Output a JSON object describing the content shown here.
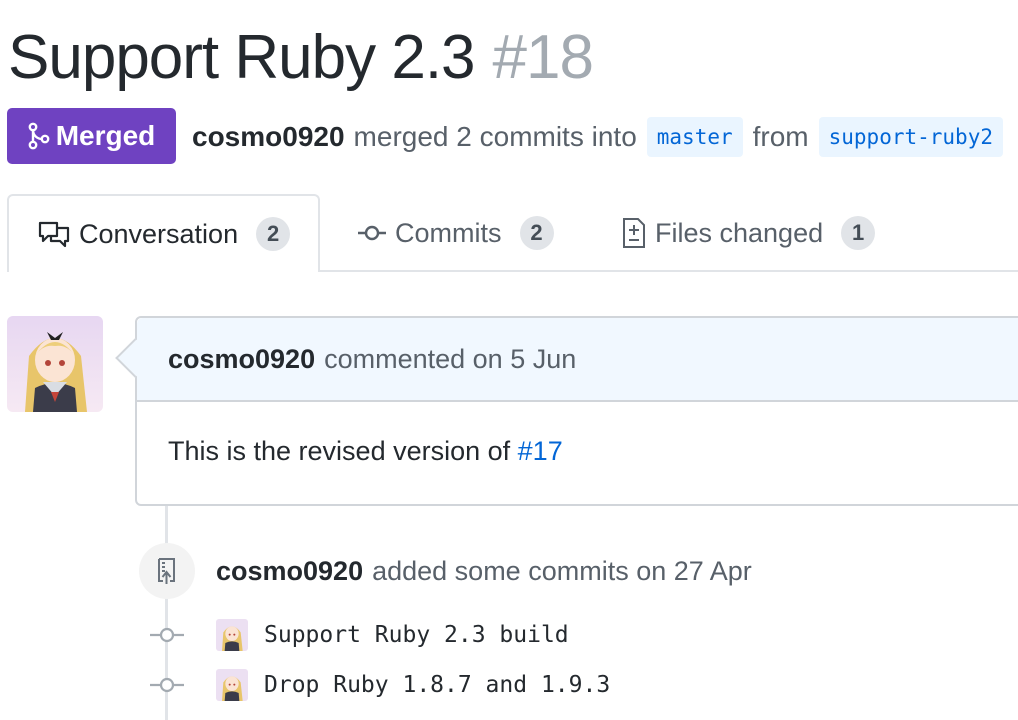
{
  "pr": {
    "title": "Support Ruby 2.3",
    "number": "#18",
    "state": "Merged",
    "author": "cosmo0920",
    "merged_text": "merged 2 commits into",
    "base_branch": "master",
    "from_text": "from",
    "head_branch": "support-ruby2"
  },
  "tabs": [
    {
      "label": "Conversation",
      "count": "2",
      "icon": "comment-discussion-icon"
    },
    {
      "label": "Commits",
      "count": "2",
      "icon": "git-commit-icon"
    },
    {
      "label": "Files changed",
      "count": "1",
      "icon": "file-diff-icon"
    }
  ],
  "comment": {
    "author": "cosmo0920",
    "action": "commented on 5 Jun",
    "body_prefix": "This is the revised version of",
    "body_link": "#17"
  },
  "event": {
    "author": "cosmo0920",
    "action": "added some commits on 27 Apr",
    "icon": "repo-push-icon"
  },
  "commits": [
    {
      "message": "Support Ruby 2.3 build"
    },
    {
      "message": "Drop Ruby 1.8.7 and 1.9.3"
    }
  ],
  "colors": {
    "merged": "#6f42c1",
    "link": "#0366d6",
    "branch_bg": "#eaf5ff",
    "comment_header_bg": "#f1f8ff"
  }
}
